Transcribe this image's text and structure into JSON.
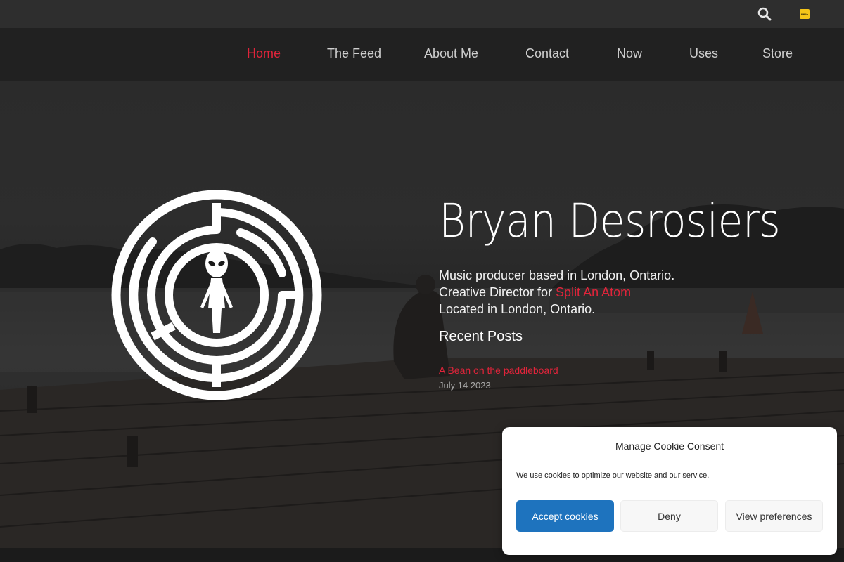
{
  "header": {
    "search_icon": "search-icon",
    "imdb_icon": "imdb-icon",
    "imdb_label": "IMDb"
  },
  "nav": {
    "items": [
      {
        "label": "Home",
        "active": true
      },
      {
        "label": "The Feed"
      },
      {
        "label": "About Me"
      },
      {
        "label": "Contact"
      },
      {
        "label": "Now"
      },
      {
        "label": "Uses"
      },
      {
        "label": "Store"
      }
    ]
  },
  "hero": {
    "title": "Bryan Desrosiers",
    "bio_line1": "Music producer based in London, Ontario.",
    "bio_line2_prefix": "Creative Director for ",
    "bio_line2_link": "Split An Atom",
    "bio_line3": "Located in London, Ontario.",
    "recent_posts_heading": "Recent Posts",
    "posts": [
      {
        "title": "A Bean on the paddleboard",
        "date": "July 14 2023"
      }
    ]
  },
  "cookie_banner": {
    "title": "Manage Cookie Consent",
    "message": "We use cookies to optimize our website and our service.",
    "accept_label": "Accept cookies",
    "deny_label": "Deny",
    "preferences_label": "View preferences"
  },
  "colors": {
    "accent": "#e0243a",
    "accept_button": "#1e73be",
    "navbar": "#212121",
    "topbar": "#2e2e2e"
  }
}
